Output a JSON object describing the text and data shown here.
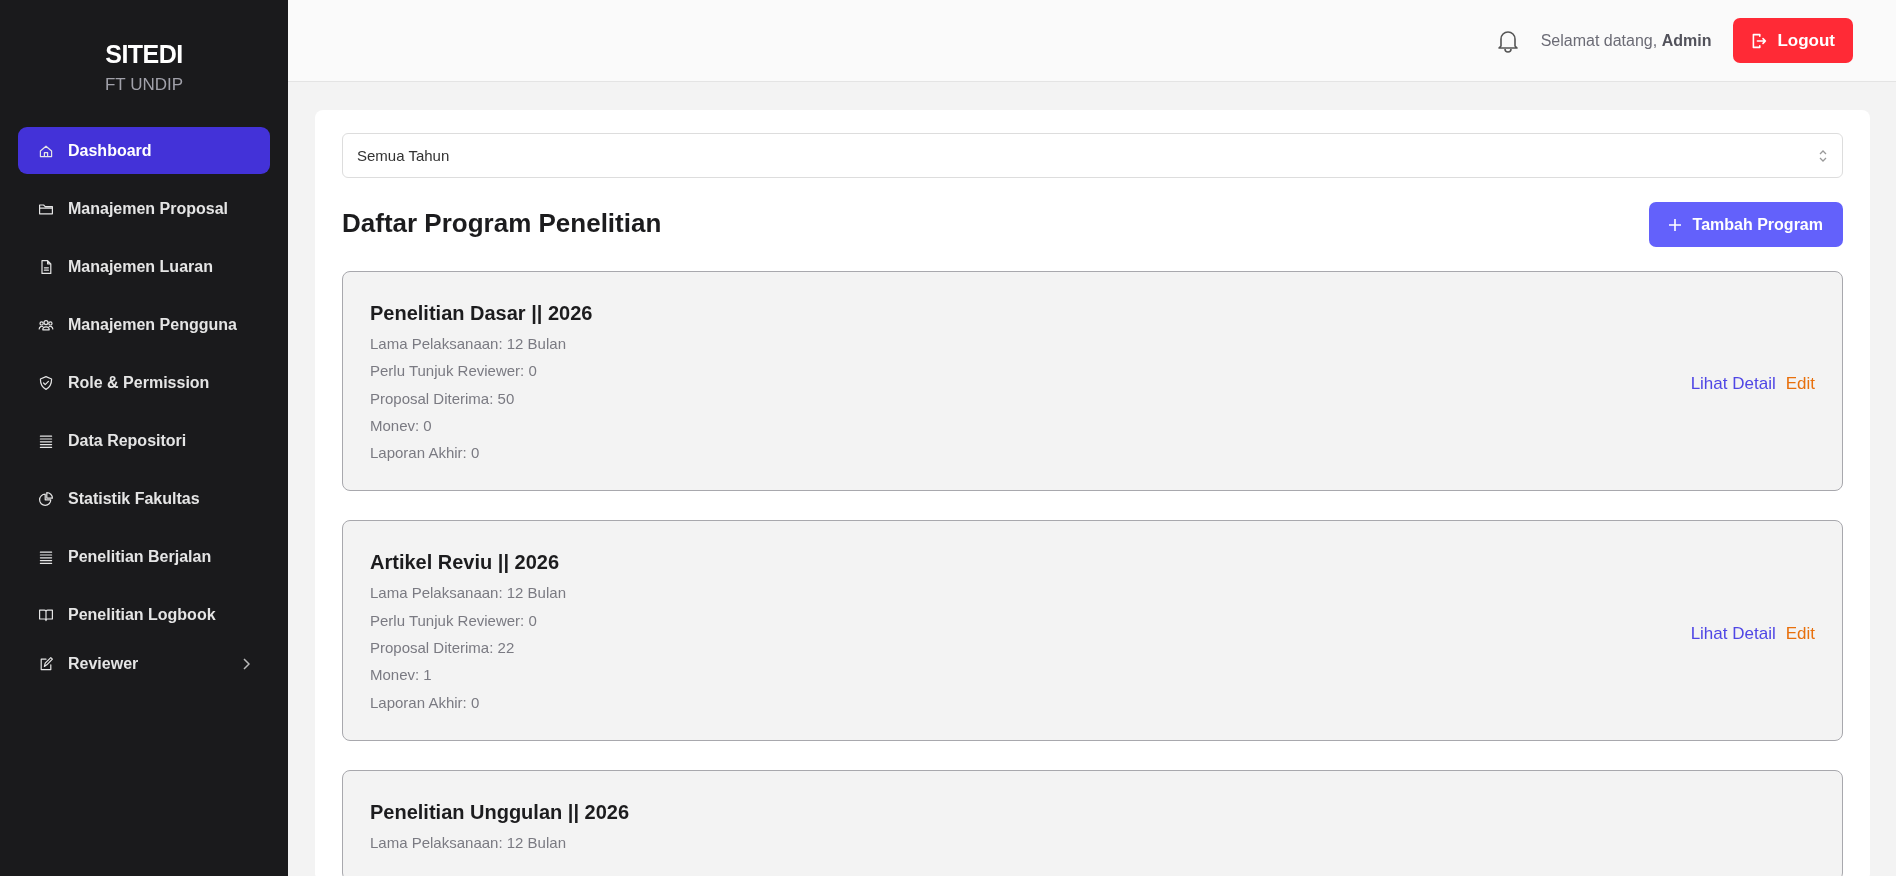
{
  "sidebar": {
    "title": "SITEDI",
    "subtitle": "FT UNDIP",
    "items": [
      {
        "label": "Dashboard",
        "kind": "link",
        "selected": true
      },
      {
        "label": "Manajemen Proposal",
        "kind": "link",
        "selected": false
      },
      {
        "label": "Manajemen Luaran",
        "kind": "link",
        "selected": false
      },
      {
        "label": "Manajemen Pengguna",
        "kind": "link",
        "selected": false
      },
      {
        "label": "Role & Permission",
        "kind": "link",
        "selected": false
      },
      {
        "label": "Data Repositori",
        "kind": "link",
        "selected": false
      },
      {
        "label": "Statistik Fakultas",
        "kind": "link",
        "selected": false
      },
      {
        "label": "Penelitian Berjalan",
        "kind": "link",
        "selected": false
      },
      {
        "label": "Penelitian Logbook",
        "kind": "link",
        "selected": false
      },
      {
        "label": "Reviewer",
        "kind": "group",
        "selected": false
      }
    ]
  },
  "header": {
    "greeting": "Selamat datang, **Admin**",
    "logout": "Logout"
  },
  "year_filter": {
    "value": "Semua Tahun"
  },
  "heading": "Daftar Program Penelitian",
  "add_button": "Tambah Program",
  "programs": [
    {
      "title": "Penelitian Dasar || 2026",
      "details": [
        "Lama Pelaksanaan: 12 Bulan",
        "Perlu Tunjuk Reviewer: 0",
        "Proposal Diterima: 50",
        "Monev: 0",
        "Laporan Akhir: 0"
      ],
      "actions": [
        "Lihat Detail",
        "Edit"
      ]
    },
    {
      "title": "Artikel Reviu || 2026",
      "details": [
        "Lama Pelaksanaan: 12 Bulan",
        "Perlu Tunjuk Reviewer: 0",
        "Proposal Diterima: 22",
        "Monev: 1",
        "Laporan Akhir: 0"
      ],
      "actions": [
        "Lihat Detail",
        "Edit"
      ]
    },
    {
      "title": "Penelitian Unggulan || 2026",
      "details": [
        "Lama Pelaksanaan: 12 Bulan"
      ]
    }
  ]
}
